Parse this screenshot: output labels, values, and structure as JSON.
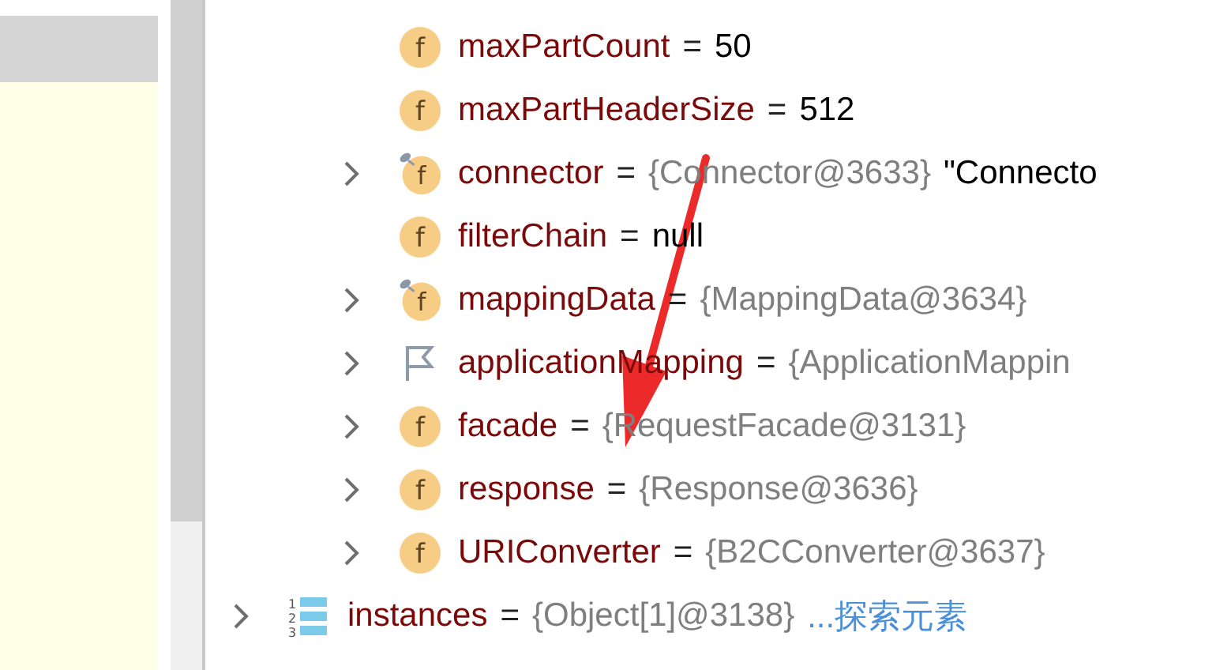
{
  "tree": [
    {
      "children": [
        {
          "kind": "field",
          "icon_text": "f",
          "name": "maxPartCount",
          "equals": "=",
          "value": "50"
        },
        {
          "kind": "field",
          "icon_text": "f",
          "name": "maxPartHeaderSize",
          "equals": "=",
          "value": "512"
        },
        {
          "kind": "pinned",
          "icon_text": "f",
          "name": "connector",
          "equals": "=",
          "reference": "{Connector@3633}",
          "expanded": false,
          "extra": "\"Connecto"
        },
        {
          "kind": "field",
          "icon_text": "f",
          "name": "filterChain",
          "equals": "=",
          "value": "null"
        },
        {
          "kind": "pinned",
          "icon_text": "f",
          "name": "mappingData",
          "equals": "=",
          "reference": "{MappingData@3634}",
          "expanded": false
        },
        {
          "kind": "flag",
          "name": "applicationMapping",
          "equals": "=",
          "reference": "{ApplicationMappin",
          "expanded": false
        },
        {
          "kind": "field",
          "icon_text": "f",
          "name": "facade",
          "equals": "=",
          "reference": "{RequestFacade@3131}",
          "expanded": false
        },
        {
          "kind": "field",
          "icon_text": "f",
          "name": "response",
          "equals": "=",
          "reference": "{Response@3636}",
          "expanded": false
        },
        {
          "kind": "field",
          "icon_text": "f",
          "name": "URIConverter",
          "equals": "=",
          "reference": "{B2CConverter@3637}",
          "expanded": false
        }
      ]
    },
    {
      "kind": "array",
      "icon_digits": [
        "1",
        "2",
        "3"
      ],
      "name": "instances",
      "equals": "=",
      "reference": "{Object[1]@3138}",
      "expanded": false,
      "link": "...探索元素"
    }
  ]
}
